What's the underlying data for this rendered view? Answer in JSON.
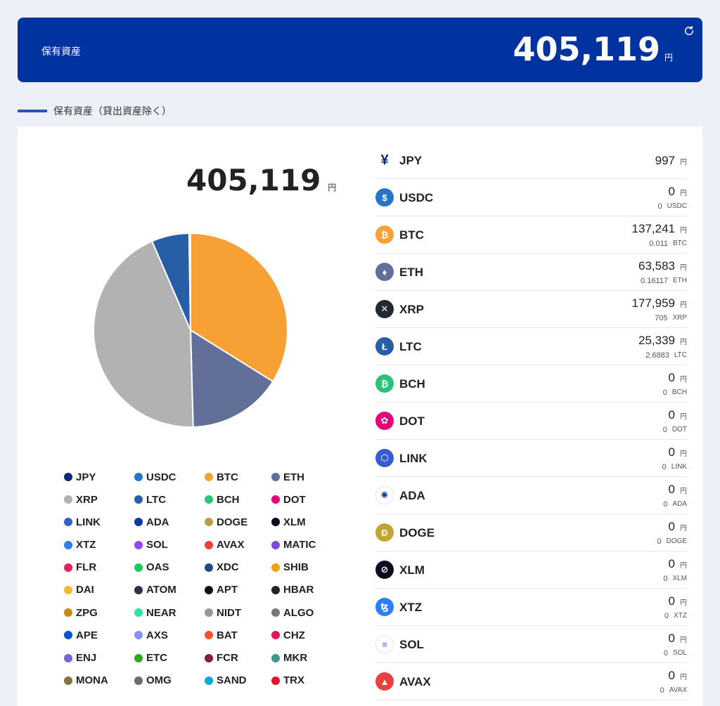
{
  "banner": {
    "label": "保有資産",
    "amount": "405,119",
    "unit": "円"
  },
  "section": {
    "title": "保有資産（貸出資産除く）"
  },
  "total": {
    "amount": "405,119",
    "unit": "円"
  },
  "colors": {
    "banner": "#0033a0",
    "accent": "#2456b8"
  },
  "legend": [
    {
      "label": "JPY",
      "color": "#0a2a7a"
    },
    {
      "label": "USDC",
      "color": "#2775ca"
    },
    {
      "label": "BTC",
      "color": "#f7a034"
    },
    {
      "label": "ETH",
      "color": "#627099"
    },
    {
      "label": "XRP",
      "color": "#b2b2b2"
    },
    {
      "label": "LTC",
      "color": "#275ea5"
    },
    {
      "label": "BCH",
      "color": "#2ec07f"
    },
    {
      "label": "DOT",
      "color": "#e6007a"
    },
    {
      "label": "LINK",
      "color": "#375bd2"
    },
    {
      "label": "ADA",
      "color": "#0d3aa0"
    },
    {
      "label": "DOGE",
      "color": "#baa049"
    },
    {
      "label": "XLM",
      "color": "#0b0b22"
    },
    {
      "label": "XTZ",
      "color": "#2c7df7"
    },
    {
      "label": "SOL",
      "color": "#9945ff"
    },
    {
      "label": "AVAX",
      "color": "#e84142"
    },
    {
      "label": "MATIC",
      "color": "#8247e5"
    },
    {
      "label": "FLR",
      "color": "#e62058"
    },
    {
      "label": "OAS",
      "color": "#1fc760"
    },
    {
      "label": "XDC",
      "color": "#244b81"
    },
    {
      "label": "SHIB",
      "color": "#f0a10f"
    },
    {
      "label": "DAI",
      "color": "#f5b731"
    },
    {
      "label": "ATOM",
      "color": "#2e3148"
    },
    {
      "label": "APT",
      "color": "#111111"
    },
    {
      "label": "HBAR",
      "color": "#222222"
    },
    {
      "label": "ZPG",
      "color": "#c58a12"
    },
    {
      "label": "NEAR",
      "color": "#2ce5a0"
    },
    {
      "label": "NIDT",
      "color": "#999999"
    },
    {
      "label": "ALGO",
      "color": "#777777"
    },
    {
      "label": "APE",
      "color": "#0a4fd6"
    },
    {
      "label": "AXS",
      "color": "#8a8ff0"
    },
    {
      "label": "BAT",
      "color": "#f0522c"
    },
    {
      "label": "CHZ",
      "color": "#e8135f"
    },
    {
      "label": "ENJ",
      "color": "#7866d5"
    },
    {
      "label": "ETC",
      "color": "#33a524"
    },
    {
      "label": "FCR",
      "color": "#8b1c3f"
    },
    {
      "label": "MKR",
      "color": "#3c9a8a"
    },
    {
      "label": "MONA",
      "color": "#8a7045"
    },
    {
      "label": "OMG",
      "color": "#6b6b6b"
    },
    {
      "label": "SAND",
      "color": "#0ea6e0"
    },
    {
      "label": "TRX",
      "color": "#e8112d"
    }
  ],
  "chart_data": {
    "type": "pie",
    "slices": [
      {
        "label": "BTC",
        "value": 137241,
        "color": "#f7a034"
      },
      {
        "label": "ETH",
        "value": 63583,
        "color": "#627099"
      },
      {
        "label": "XRP",
        "value": 177959,
        "color": "#b2b2b2"
      },
      {
        "label": "LTC",
        "value": 25339,
        "color": "#275ea5"
      },
      {
        "label": "JPY",
        "value": 997,
        "color": "#0a2a7a"
      }
    ]
  },
  "assets": [
    {
      "symbol": "JPY",
      "jpy": "997",
      "yen": "円",
      "qty": "",
      "unit": "",
      "icon": "yen-icon",
      "iconColor": "#ffffff",
      "glyph": "¥",
      "glyphColor": "#0a2a7a"
    },
    {
      "symbol": "USDC",
      "jpy": "0",
      "yen": "円",
      "qty": "0",
      "unit": "USDC",
      "icon": "usdc-icon",
      "iconColor": "#2775ca",
      "glyph": "$",
      "glyphColor": "#ffffff"
    },
    {
      "symbol": "BTC",
      "jpy": "137,241",
      "yen": "円",
      "qty": "0.011",
      "unit": "BTC",
      "icon": "btc-icon",
      "iconColor": "#f7a034",
      "glyph": "₿",
      "glyphColor": "#ffffff"
    },
    {
      "symbol": "ETH",
      "jpy": "63,583",
      "yen": "円",
      "qty": "0.16117",
      "unit": "ETH",
      "icon": "eth-icon",
      "iconColor": "#627099",
      "glyph": "♦",
      "glyphColor": "#ffffff"
    },
    {
      "symbol": "XRP",
      "jpy": "177,959",
      "yen": "円",
      "qty": "705",
      "unit": "XRP",
      "icon": "xrp-icon",
      "iconColor": "#23292f",
      "glyph": "✕",
      "glyphColor": "#ffffff"
    },
    {
      "symbol": "LTC",
      "jpy": "25,339",
      "yen": "円",
      "qty": "2.6883",
      "unit": "LTC",
      "icon": "ltc-icon",
      "iconColor": "#275ea5",
      "glyph": "Ł",
      "glyphColor": "#ffffff"
    },
    {
      "symbol": "BCH",
      "jpy": "0",
      "yen": "円",
      "qty": "0",
      "unit": "BCH",
      "icon": "bch-icon",
      "iconColor": "#2ec07f",
      "glyph": "₿",
      "glyphColor": "#ffffff"
    },
    {
      "symbol": "DOT",
      "jpy": "0",
      "yen": "円",
      "qty": "0",
      "unit": "DOT",
      "icon": "dot-icon",
      "iconColor": "#e6007a",
      "glyph": "✿",
      "glyphColor": "#ffffff"
    },
    {
      "symbol": "LINK",
      "jpy": "0",
      "yen": "円",
      "qty": "0",
      "unit": "LINK",
      "icon": "link-icon",
      "iconColor": "#375bd2",
      "glyph": "⬡",
      "glyphColor": "#ffffff"
    },
    {
      "symbol": "ADA",
      "jpy": "0",
      "yen": "円",
      "qty": "0",
      "unit": "ADA",
      "icon": "ada-icon",
      "iconColor": "#ffffff",
      "glyph": "✺",
      "glyphColor": "#0d3aa0"
    },
    {
      "symbol": "DOGE",
      "jpy": "0",
      "yen": "円",
      "qty": "0",
      "unit": "DOGE",
      "icon": "doge-icon",
      "iconColor": "#c2a633",
      "glyph": "Ð",
      "glyphColor": "#ffffff"
    },
    {
      "symbol": "XLM",
      "jpy": "0",
      "yen": "円",
      "qty": "0",
      "unit": "XLM",
      "icon": "xlm-icon",
      "iconColor": "#0b0b22",
      "glyph": "⊘",
      "glyphColor": "#ffffff"
    },
    {
      "symbol": "XTZ",
      "jpy": "0",
      "yen": "円",
      "qty": "0",
      "unit": "XTZ",
      "icon": "xtz-icon",
      "iconColor": "#2c7df7",
      "glyph": "ꜩ",
      "glyphColor": "#ffffff"
    },
    {
      "symbol": "SOL",
      "jpy": "0",
      "yen": "円",
      "qty": "0",
      "unit": "SOL",
      "icon": "sol-icon",
      "iconColor": "#ffffff",
      "glyph": "≡",
      "glyphColor": "#9945ff"
    },
    {
      "symbol": "AVAX",
      "jpy": "0",
      "yen": "円",
      "qty": "0",
      "unit": "AVAX",
      "icon": "avax-icon",
      "iconColor": "#e84142",
      "glyph": "▲",
      "glyphColor": "#ffffff"
    }
  ]
}
